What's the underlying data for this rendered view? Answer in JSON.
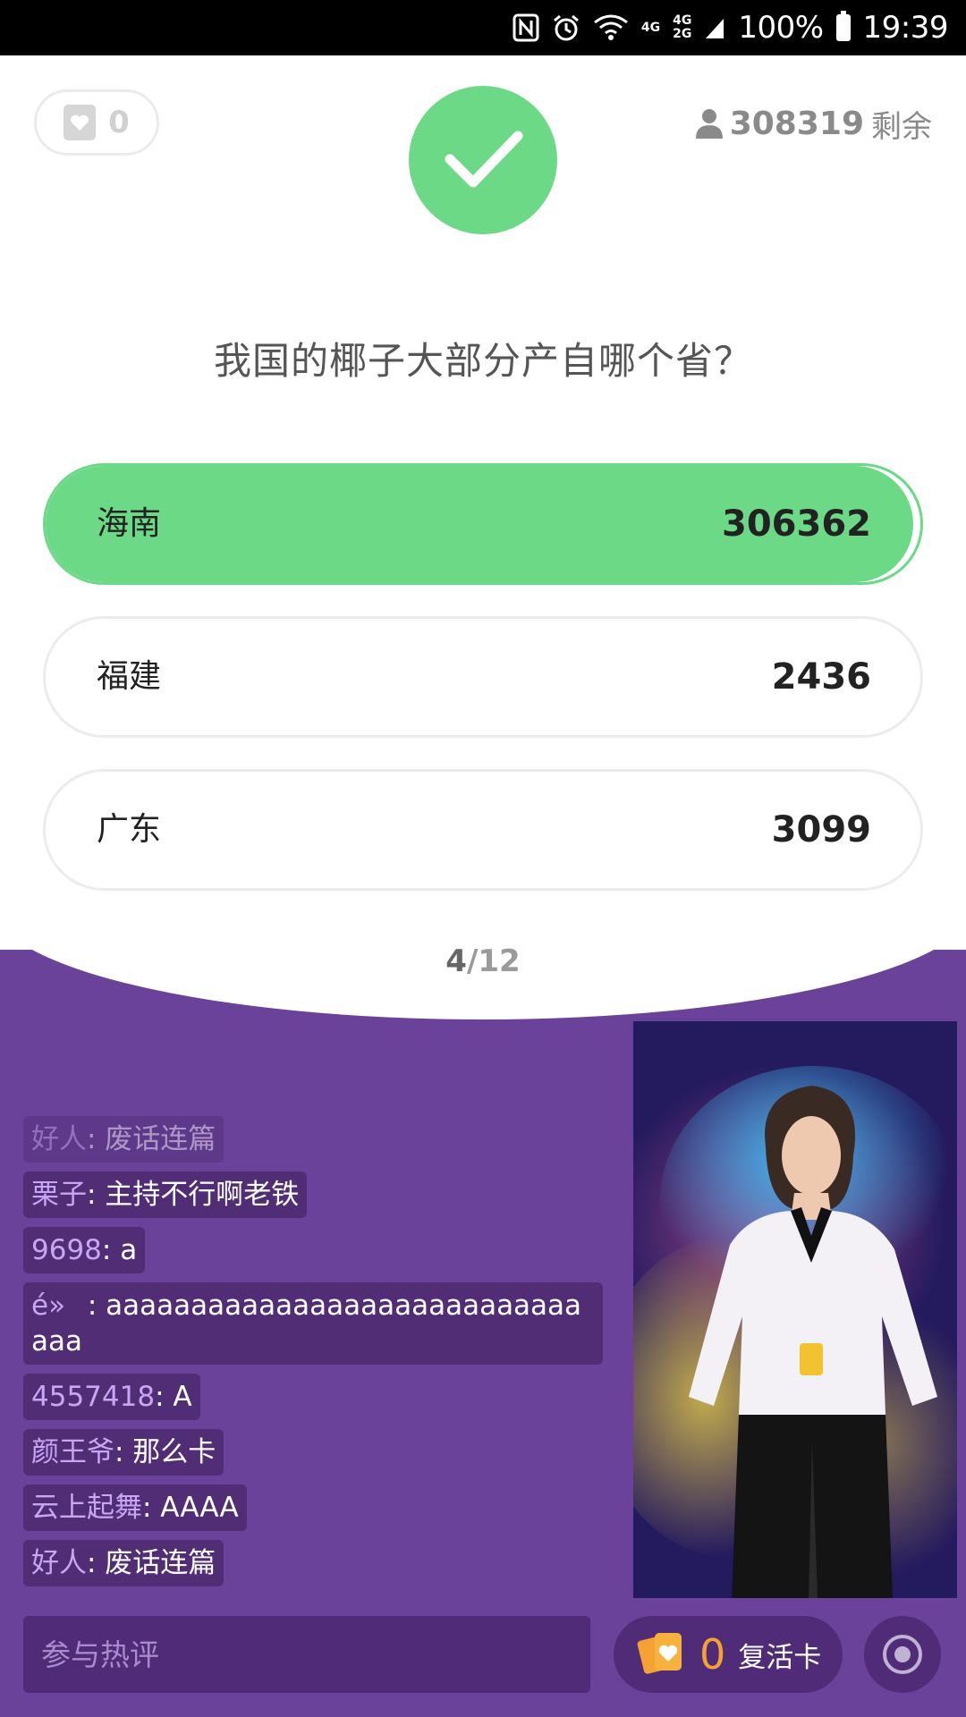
{
  "status_bar": {
    "net_top": "4G",
    "net_mid_top": "4G",
    "net_mid_bottom": "2G",
    "battery": "100%",
    "time": "19:39"
  },
  "quiz": {
    "hearts_count": "0",
    "remaining_count": "308319",
    "remaining_suffix": "剩余",
    "question": "我国的椰子大部分产自哪个省？",
    "options": [
      {
        "label": "海南",
        "votes": "306362",
        "correct": true,
        "share": 0.9921
      },
      {
        "label": "福建",
        "votes": "2436",
        "correct": false
      },
      {
        "label": "广东",
        "votes": "3099",
        "correct": false
      }
    ],
    "progress_current": "4",
    "progress_total": "/12"
  },
  "chat": [
    {
      "user": "好人",
      "text": ": 废话连篇",
      "faded": true
    },
    {
      "user": "栗子",
      "text": ": 主持不行啊老铁"
    },
    {
      "user": "9698",
      "text": ": a"
    },
    {
      "user": "é»",
      "text": ": aaaaaaaaaaaaaaaaaaaaaaaaaaaaaaa"
    },
    {
      "user": "4557418",
      "text": ": A"
    },
    {
      "user": "颜王爷",
      "text": ": 那么卡"
    },
    {
      "user": "云上起舞",
      "text": ": AAAA"
    },
    {
      "user": "好人",
      "text": ": 废话连篇"
    }
  ],
  "bottom_bar": {
    "comment_placeholder": "参与热评",
    "revive_count": "0",
    "revive_label": "复活卡"
  },
  "colors": {
    "accent_green": "#6cd986",
    "background_purple": "#6a4299",
    "revive_orange": "#f4a233"
  }
}
